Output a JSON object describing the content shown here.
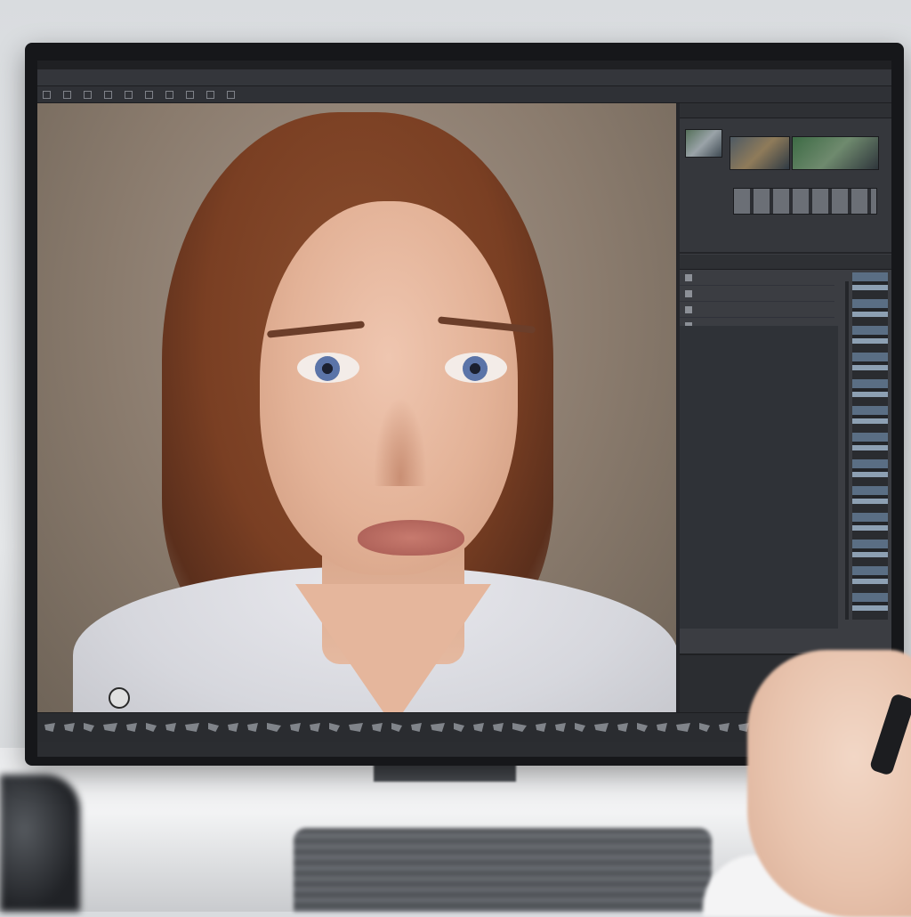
{
  "app": {
    "window_title": "",
    "logo_icon": "app-logo-icon",
    "accent_color": "#f0b21a"
  },
  "menubar": {
    "items": [
      "",
      "",
      "",
      "",
      "",
      "",
      "",
      "",
      ""
    ]
  },
  "optionsbar": {
    "items": [
      "",
      "",
      "",
      "",
      "",
      "",
      "",
      "",
      "",
      ""
    ]
  },
  "canvas": {
    "content": "portrait-photo",
    "tool_icon": "zoom-icon"
  },
  "panels": {
    "navigator": {
      "header": "",
      "footer_left": "",
      "footer_mid": "",
      "footer_right": ""
    },
    "layers": {
      "tabs": [
        "",
        "",
        ""
      ],
      "rows": [
        {
          "label": ""
        },
        {
          "label": ""
        },
        {
          "label": ""
        },
        {
          "label": ""
        }
      ]
    }
  },
  "statusbar": {
    "tool_icons": [
      "move-icon",
      "select-icon",
      "lasso-icon",
      "crop-icon",
      "eyedropper-icon",
      "heal-icon",
      "brush-icon",
      "stamp-icon",
      "history-icon",
      "eraser-icon",
      "gradient-icon",
      "blur-icon",
      "dodge-icon",
      "pen-icon",
      "type-icon",
      "path-icon",
      "shape-icon",
      "hand-icon",
      "zoom-icon"
    ]
  }
}
